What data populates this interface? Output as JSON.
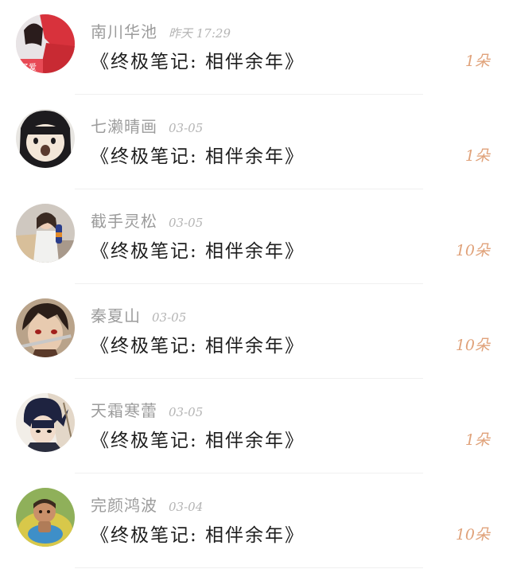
{
  "rows": [
    {
      "username": "南川华池",
      "time": "昨天 17:29",
      "title": "《终极笔记:  相伴余年》",
      "count": "1朵",
      "avatar": "avatar-photo-girl-red"
    },
    {
      "username": "七濑晴画",
      "time": "03-05",
      "title": "《终极笔记:  相伴余年》",
      "count": "1朵",
      "avatar": "avatar-cartoon-girl"
    },
    {
      "username": "截手灵松",
      "time": "03-05",
      "title": "《终极笔记:  相伴余年》",
      "count": "10朵",
      "avatar": "avatar-photo-girl-bottle"
    },
    {
      "username": "秦夏山",
      "time": "03-05",
      "title": "《终极笔记:  相伴余年》",
      "count": "10朵",
      "avatar": "avatar-anime-swordsman"
    },
    {
      "username": "天霜寒蕾",
      "time": "03-05",
      "title": "《终极笔记:  相伴余年》",
      "count": "1朵",
      "avatar": "avatar-anime-ninja"
    },
    {
      "username": "完颜鸿波",
      "time": "03-04",
      "title": "《终极笔记:  相伴余年》",
      "count": "10朵",
      "avatar": "avatar-photo-baby"
    }
  ],
  "colors": {
    "username": "#9c9c9c",
    "time": "#b4b4b4",
    "title": "#1e1e1e",
    "count": "#e0a27a",
    "divider": "#f0f0f0"
  }
}
